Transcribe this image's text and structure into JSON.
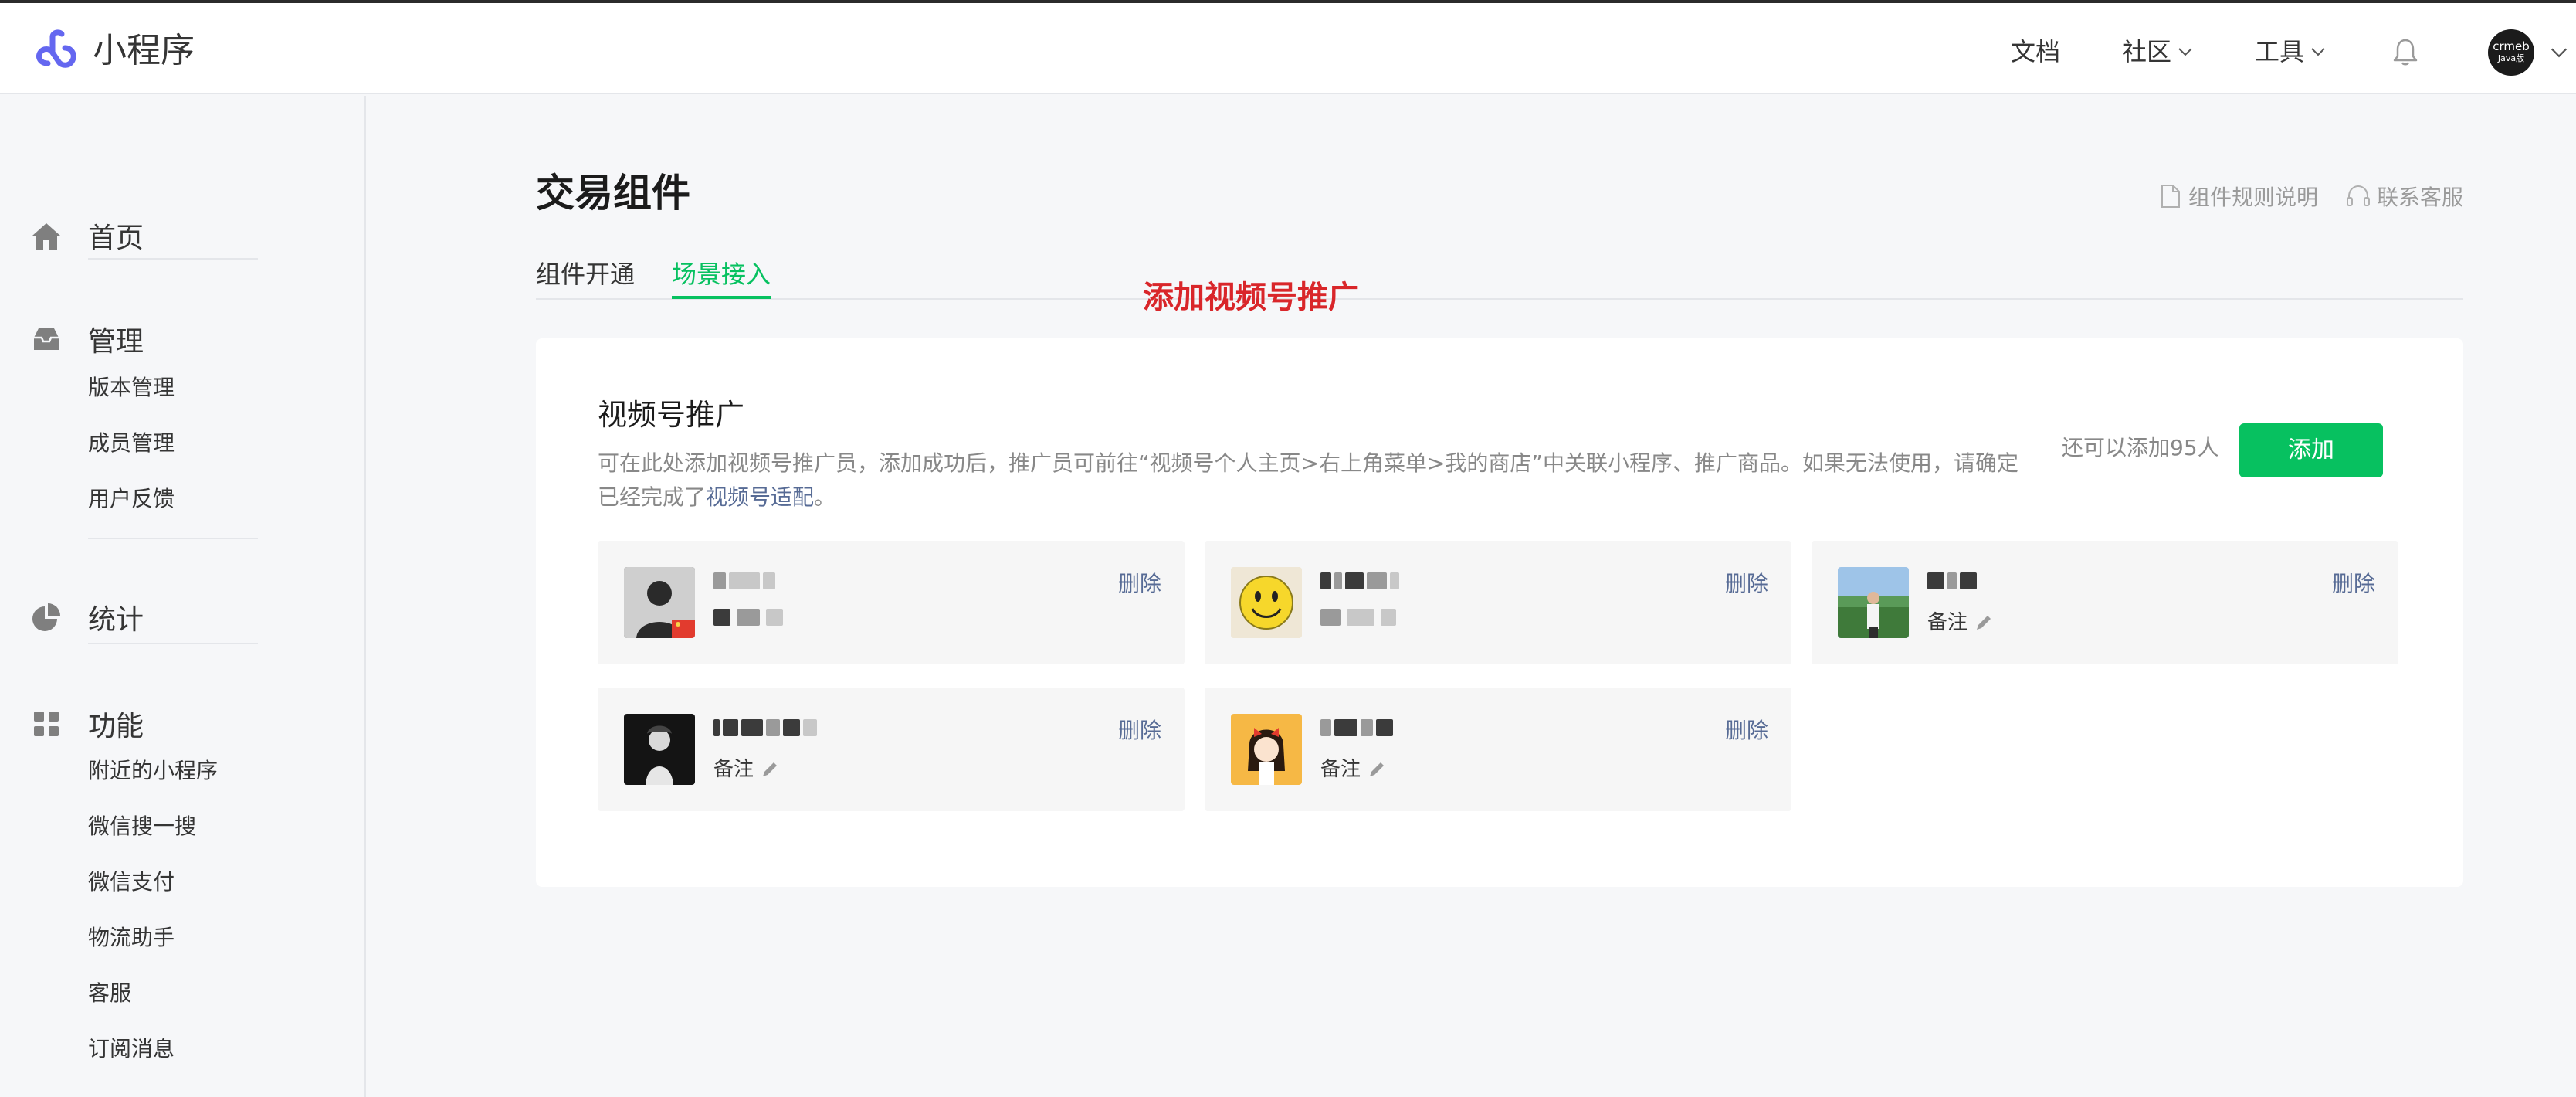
{
  "header": {
    "brand": "小程序",
    "nav": [
      {
        "label": "文档"
      },
      {
        "label": "社区"
      },
      {
        "label": "工具"
      }
    ],
    "avatar_text_line1": "crmeb",
    "avatar_text_line2": "Java版"
  },
  "sidebar": {
    "sections": [
      {
        "title": "首页",
        "icon": "home-icon"
      },
      {
        "title": "管理",
        "icon": "inbox-icon",
        "items": [
          "版本管理",
          "成员管理",
          "用户反馈"
        ]
      },
      {
        "title": "统计",
        "icon": "pie-chart-icon"
      },
      {
        "title": "功能",
        "icon": "grid-icon",
        "items": [
          "附近的小程序",
          "微信搜一搜",
          "微信支付",
          "物流助手",
          "客服",
          "订阅消息"
        ]
      }
    ]
  },
  "main": {
    "title": "交易组件",
    "links": {
      "rules": "组件规则说明",
      "support": "联系客服"
    },
    "tabs": [
      {
        "label": "组件开通",
        "active": false
      },
      {
        "label": "场景接入",
        "active": true
      }
    ],
    "annotation": "添加视频号推广",
    "card": {
      "title": "视频号推广",
      "description": "可在此处添加视频号推广员，添加成功后，推广员可前往“视频号个人主页>右上角菜单>我的商店”中关联小程序、推广商品。如果无法使用，请确定已经完成了",
      "description_link": "视频号适配",
      "description_end": "。",
      "remaining": "还可以添加95人",
      "add_label": "添加",
      "delete_label": "删除",
      "remark_label": "备注"
    }
  },
  "colors": {
    "accent_green": "#07c160",
    "link_blue": "#576b95",
    "annotation_red": "#d9262a"
  }
}
